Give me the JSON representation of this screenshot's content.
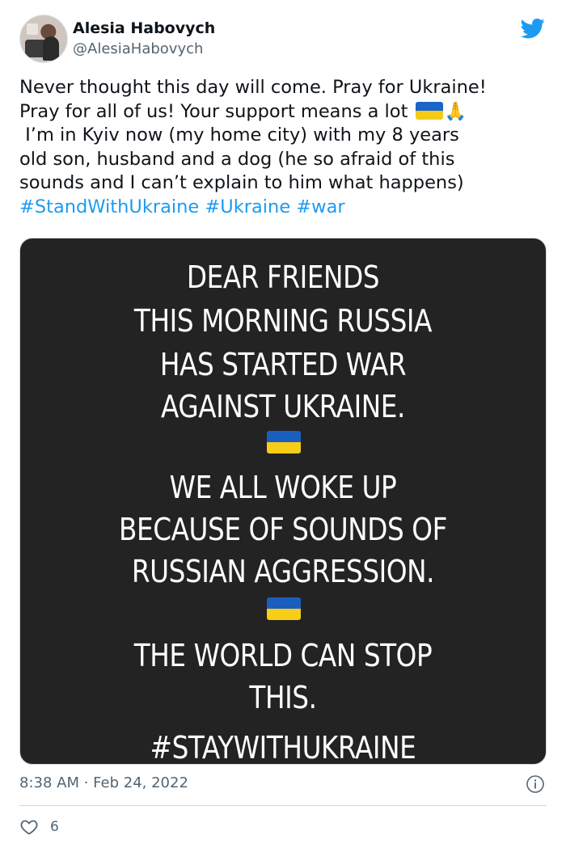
{
  "author": {
    "name": "Alesia Habovych",
    "handle": "@AlesiaHabovych"
  },
  "tweet": {
    "line1": "Never thought this day will come. Pray for Ukraine!",
    "line2": "Pray for all of us! Your support means a lot ",
    "line3": " I’m in Kyiv now (my home city) with my 8 years",
    "line4": "old son, husband and a dog (he so afraid of this",
    "line5": "sounds and I can’t explain to him what happens)",
    "hashtags": [
      "#StandWithUkraine",
      "#Ukraine",
      "#war"
    ],
    "emoji_hands": "🙏"
  },
  "media": {
    "lines": [
      "DEAR FRIENDS",
      "THIS MORNING RUSSIA",
      "HAS STARTED WAR",
      "AGAINST UKRAINE.",
      "WE ALL WOKE UP",
      "BECAUSE OF SOUNDS OF",
      "RUSSIAN AGGRESSION.",
      "THE WORLD CAN STOP",
      "THIS.",
      "#STAYWITHUKRAINE"
    ]
  },
  "meta": {
    "timestamp": "8:38 AM · Feb 24, 2022"
  },
  "engagement": {
    "likes": "6"
  },
  "colors": {
    "hashtag": "#1d9bf0",
    "twitter_blue": "#1d9bf0",
    "flag_blue": "#1a64c8",
    "flag_yellow": "#f6c915"
  },
  "icons": {
    "logo": "twitter-bird-icon",
    "info": "info-icon",
    "like": "heart-icon"
  }
}
